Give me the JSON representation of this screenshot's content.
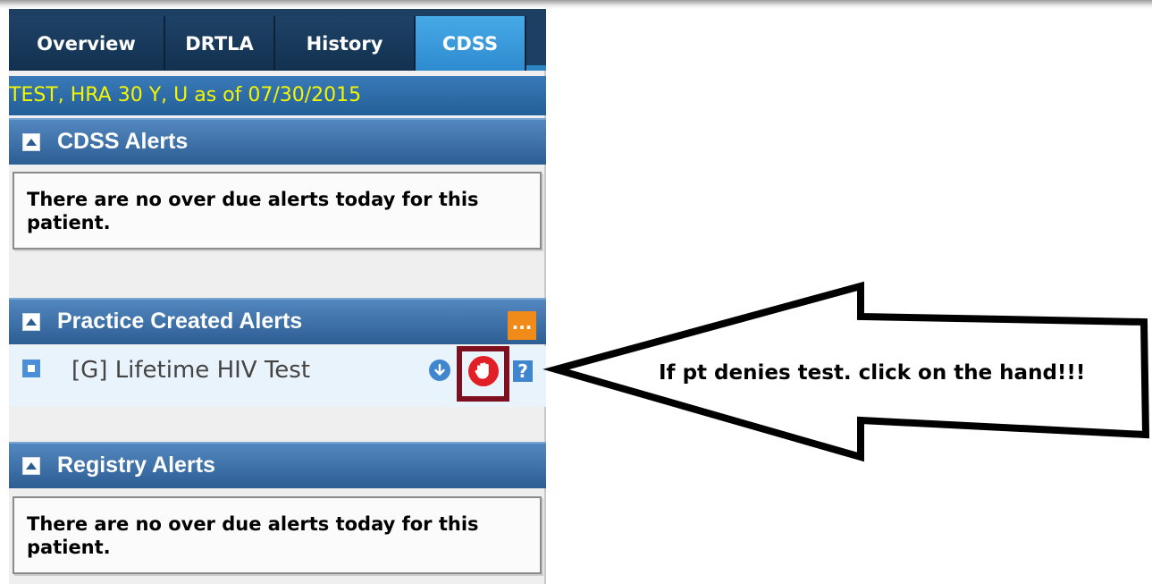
{
  "tabs": [
    {
      "label": "Overview",
      "active": false
    },
    {
      "label": "DRTLA",
      "active": false
    },
    {
      "label": "History",
      "active": false
    },
    {
      "label": "CDSS",
      "active": true
    }
  ],
  "patient_info": "TEST, HRA 30 Y, U as of 07/30/2015",
  "sections": {
    "cdss_alerts": {
      "title": "CDSS Alerts",
      "message": "There are no over due alerts today for this patient."
    },
    "practice_alerts": {
      "title": "Practice Created Alerts",
      "more_label": "...",
      "items": [
        {
          "label": "[G] Lifetime HIV Test",
          "help_label": "?"
        }
      ]
    },
    "registry_alerts": {
      "title": "Registry Alerts",
      "message": "There are no over due alerts today for this patient."
    }
  },
  "annotation": {
    "text": "If pt denies test.  click on the hand!!!"
  },
  "icons": {
    "toggle": "collapse-triangle-icon",
    "row_bullet": "bullet-icon",
    "down": "download-arrow-icon",
    "hand": "stop-hand-icon",
    "help": "help-icon",
    "more": "more-icon"
  },
  "colors": {
    "tab_bar": "#1d3f61",
    "active_tab": "#3a9be0",
    "patient_text": "#f4f500",
    "section_header": "#3d6fa5",
    "hand_highlight": "#7d0f1f",
    "hand_icon": "#e21f26",
    "more_button": "#f08b1a"
  }
}
